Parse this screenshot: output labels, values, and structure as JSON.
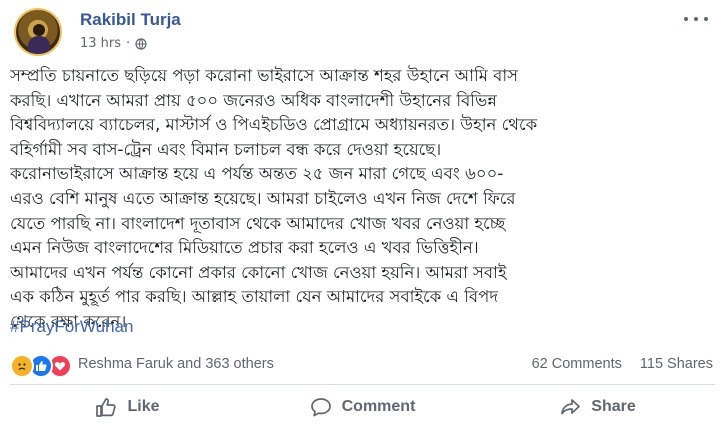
{
  "post": {
    "author": "Rakibil Turja",
    "time": "13 hrs",
    "privacy_icon": "globe-icon",
    "body_lines": [
      "সম্প্রতি চায়নাতে ছড়িয়ে পড়া করোনা ভাইরাসে আক্রান্ত শহর উহানে আমি বাস",
      "করছি। এখানে আমরা প্রায় ৫০০ জনেরও অধিক বাংলাদেশী উহানের বিভিন্ন",
      "বিশ্ববিদ্যালয়ে ব্যাচেলর, মাস্টার্স ও পিএইচডিও প্রোগ্রামে অধ্যায়নরত। উহান থেকে",
      "বহির্গামী সব বাস-ট্রেন এবং বিমান চলাচল বন্ধ করে দেওয়া হয়েছে।",
      "করোনাভাইরাসে আক্রান্ত হয়ে এ পর্যন্ত অন্তত ২৫ জন মারা গেছে এবং ৬০০-",
      "এরও বেশি মানুষ এতে আক্রান্ত হয়েছে। আমরা চাইলেও এখন নিজ দেশে ফিরে",
      "যেতে পারছি না। বাংলাদেশ দূতাবাস থেকে আমাদের খোজ খবর নেওয়া হচ্ছে",
      "এমন নিউজ বাংলাদেশের মিডিয়াতে প্রচার করা হলেও এ খবর ভিত্তিহীন।",
      "আমাদের এখন পর্যন্ত কোনো প্রকার কোনো খোজ নেওয়া হয়নি। আমরা সবাই",
      "এক কঠিন মুহূর্ত পার করছি। আল্লাহ তায়ালা যেন আমাদের সবাইকে এ বিপদ",
      "থেকে রক্ষা করেন।"
    ],
    "hashtag": "#PrayForWuhan"
  },
  "reactions": {
    "icons": [
      "sad-reaction-icon",
      "like-reaction-icon",
      "love-reaction-icon"
    ],
    "names": "Reshma Faruk and 363 others",
    "comments": "62 Comments",
    "shares": "115 Shares"
  },
  "actions": {
    "like": "Like",
    "comment": "Comment",
    "share": "Share"
  },
  "colors": {
    "author": "#365899",
    "hashtag": "#4267b2",
    "muted": "#606770",
    "like_blue": "#1877f2",
    "love_red": "#f33e58",
    "sad_yellow": "#f7b125"
  }
}
